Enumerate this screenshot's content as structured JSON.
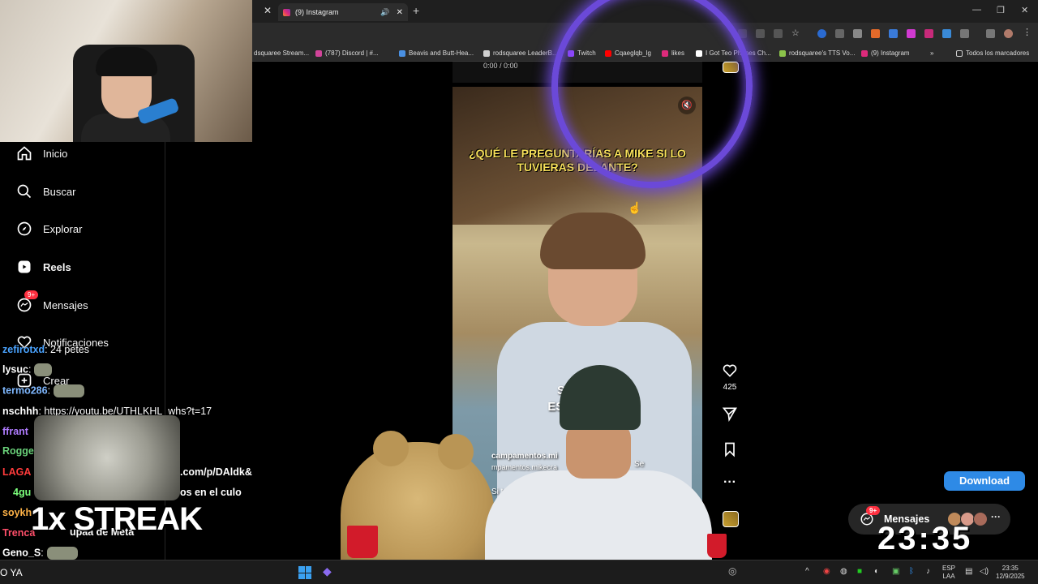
{
  "browser": {
    "tab_title": "(9) Instagram",
    "bookmarks": [
      "dsquaree Stream...",
      "(787) Discord | #...",
      "Beavis and Butt-Hea...",
      "rodsquaree LeaderB...",
      "Twitch",
      "Cqaeglqb_lg",
      "likes",
      "I Got Teo Phones Ch...",
      "rodsquaree's TTS Vo...",
      "(9) Instagram"
    ],
    "bookmarks_folder": "Todos los marcadores",
    "bookmark_colors": [
      "#7b7b7b",
      "#d2449a",
      "#4a90e2",
      "#cfcfcf",
      "#9146ff",
      "#ff0000",
      "#dd2a7b",
      "#ffffff",
      "#8bc34a",
      "#dd2a7b"
    ]
  },
  "sidebar": {
    "items": [
      {
        "label": "Inicio",
        "icon": "home-icon"
      },
      {
        "label": "Buscar",
        "icon": "search-icon"
      },
      {
        "label": "Explorar",
        "icon": "compass-icon"
      },
      {
        "label": "Reels",
        "icon": "reels-icon"
      },
      {
        "label": "Mensajes",
        "icon": "messenger-icon",
        "badge": "9+"
      },
      {
        "label": "Notificaciones",
        "icon": "heart-icon"
      },
      {
        "label": "Crear",
        "icon": "plus-icon"
      }
    ]
  },
  "chat": {
    "lines": [
      {
        "user": "zefirotxd",
        "color": "#4aa3ff",
        "msg": ": 24 petes"
      },
      {
        "user": "lysuc",
        "color": "#ffffff",
        "msg": ":"
      },
      {
        "user": "termo286",
        "color": "#7fb8ff",
        "msg": ":"
      },
      {
        "user": "nschhh",
        "color": "#ffffff",
        "msg": ": https://youtu.be/UTHLKHL_whs?t=17"
      },
      {
        "user": "ffrant",
        "color": "#b07cff",
        "msg": ""
      },
      {
        "user": "Rogge",
        "color": "#6ad17a",
        "msg": ""
      },
      {
        "user": "LAGA",
        "color": "#ff3b3b",
        "msg": ""
      },
      {
        "user": "4gu",
        "color": "#7cff7c",
        "msg": ""
      },
      {
        "user": "soykh",
        "color": "#ffb347",
        "msg": ""
      },
      {
        "user": "Trenca",
        "color": "#ff4f6a",
        "msg": ""
      },
      {
        "user": "Geno_S",
        "color": "#ffffff",
        "msg": ":"
      }
    ],
    "overlay_fragments": [
      ".com/p/DAldk&",
      "os en el culo",
      "upaa de Meta"
    ],
    "streak_text": "1x STREAK"
  },
  "reel": {
    "time": "0:00 / 0:00",
    "caption": "¿QUÉ LE PREGUNTARÍAS A MIKE SI LO TUVIERAS DELANTE?",
    "subtitle_line1": "SI MI        K",
    "subtitle_line2": "ESTUV        UÍ,",
    "account": "campamentos.mi",
    "audio": "mpamentos.mikecra",
    "follow": "Se",
    "desc": "Si tuvieras",
    "likes": "425"
  },
  "actions": {
    "download_label": "Download",
    "messages_label": "Mensajes",
    "messages_badge": "9+"
  },
  "stream": {
    "clock": "23:35"
  },
  "taskbar": {
    "left_text": "O YA",
    "lang_top": "ESP",
    "lang_bottom": "LAA",
    "time": "23:35",
    "date": "12/9/2025"
  }
}
